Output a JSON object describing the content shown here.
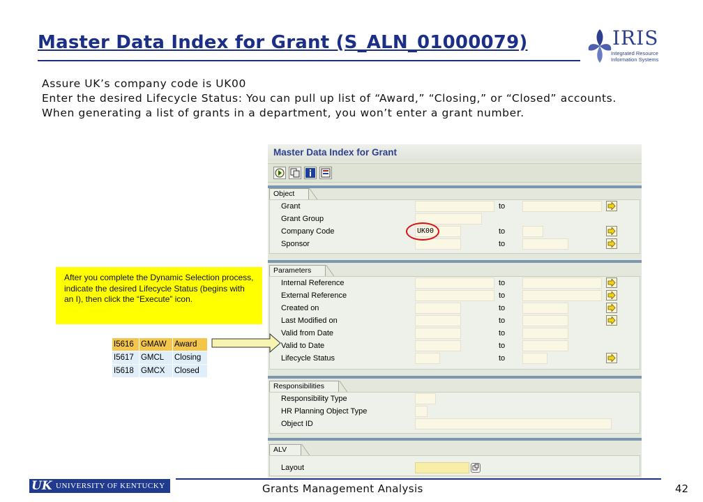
{
  "slide": {
    "title": "Master Data Index for Grant (S_ALN_01000079)",
    "intro": [
      "Assure UK’s company code is UK00",
      "Enter the desired Lifecycle Status: You can pull up list of “Award,” “Closing,” or “Closed” accounts.",
      "When generating a list of grants in a department, you won’t enter a grant number."
    ],
    "footer": "Grants Management Analysis",
    "page_number": "42"
  },
  "iris_logo": {
    "word": "IRIS",
    "sub_line1": "Integrated Resource",
    "sub_line2": "Information Systems"
  },
  "uk_logo": {
    "mark": "UK",
    "name": "UNIVERSITY OF KENTUCKY"
  },
  "sap": {
    "title": "Master Data Index for Grant",
    "toolbar_icons": [
      "execute-icon",
      "copy-icon",
      "info-icon",
      "selection-icon"
    ],
    "groups": {
      "object": "Object",
      "parameters": "Parameters",
      "responsibilities": "Responsibilities",
      "alv": "ALV"
    },
    "to_label": "to",
    "fields": {
      "grant": "Grant",
      "grant_group": "Grant Group",
      "company_code": "Company Code",
      "company_code_value": "UK00",
      "sponsor": "Sponsor",
      "internal_reference": "Internal Reference",
      "external_reference": "External Reference",
      "created_on": "Created on",
      "last_modified_on": "Last Modified on",
      "valid_from_date": "Valid from Date",
      "valid_to_date": "Valid to Date",
      "lifecycle_status": "Lifecycle Status",
      "responsibility_type": "Responsibility Type",
      "hr_planning_object_type": "HR Planning Object Type",
      "object_id": "Object ID",
      "layout": "Layout"
    }
  },
  "callout": {
    "text": "After you complete the Dynamic Selection process, indicate the desired Lifecycle Status (begins with an I), then click the “Execute” icon."
  },
  "status_table": [
    [
      "I5616",
      "GMAW",
      "Award"
    ],
    [
      "I5617",
      "GMCL",
      "Closing"
    ],
    [
      "I5618",
      "GMCX",
      "Closed"
    ]
  ],
  "colors": {
    "title_blue": "#1b2f86",
    "sap_title_blue": "#2e3f8f",
    "callout_yellow": "#ffff00",
    "highlight_circle": "#d81414"
  }
}
